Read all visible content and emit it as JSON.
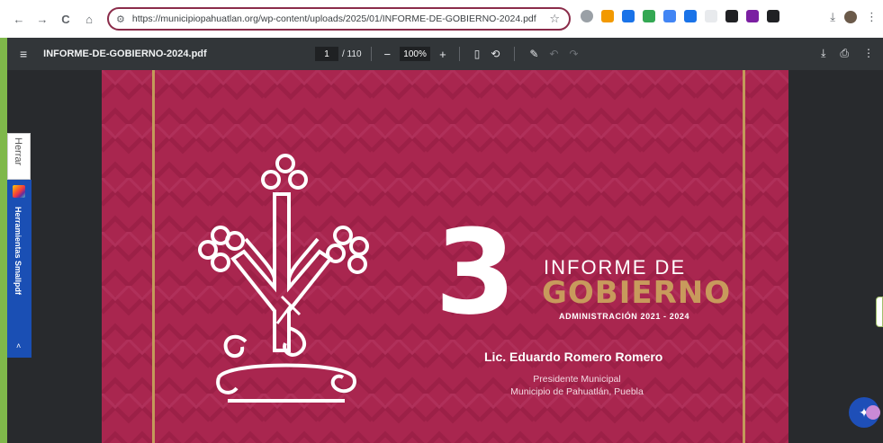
{
  "browser": {
    "url": "https://municipiopahuatlan.org/wp-content/uploads/2025/01/INFORME-DE-GOBIERNO-2024.pdf",
    "nav": {
      "back": "←",
      "forward": "→",
      "reload": "C",
      "home": "⌂"
    },
    "tune_icon": "⚙",
    "star_icon": "☆",
    "download_icon": "⤓",
    "menu_icon": "⋮",
    "extension_colors": [
      "#9aa0a6",
      "#f29900",
      "#1a73e8",
      "#34a853",
      "#4285f4",
      "#1a73e8",
      "#e8eaed",
      "#202124",
      "#7b1fa2",
      "#202124"
    ]
  },
  "pdf_viewer": {
    "menu_icon": "≡",
    "title": "INFORME-DE-GOBIERNO-2024.pdf",
    "current_page": "1",
    "total_pages": "/ 110",
    "zoom_out": "−",
    "zoom_value": "100%",
    "zoom_in": "+",
    "fit_icon": "▯",
    "rotate_icon": "⟲",
    "annotate_icon": "✎",
    "undo_icon": "↶",
    "redo_icon": "↷",
    "download_icon": "⤓",
    "print_icon": "⎙",
    "more_icon": "⋮"
  },
  "document": {
    "number": "3",
    "line1": "INFORME DE",
    "line2": "GOBIERNO",
    "administration": "ADMINISTRACIÓN 2021 - 2024",
    "person": "Lic. Eduardo Romero Romero",
    "role1": "Presidente Municipal",
    "role2": "Municipio de Pahuatlán, Puebla",
    "colors": {
      "background": "#a9264f",
      "gold": "#c89a5c",
      "white": "#ffffff"
    }
  },
  "side_tools": {
    "tab_label": "Herrar",
    "panel_label": "Herramientas Smallpdf",
    "caret": "˄"
  },
  "fab": {
    "icon": "✦"
  }
}
